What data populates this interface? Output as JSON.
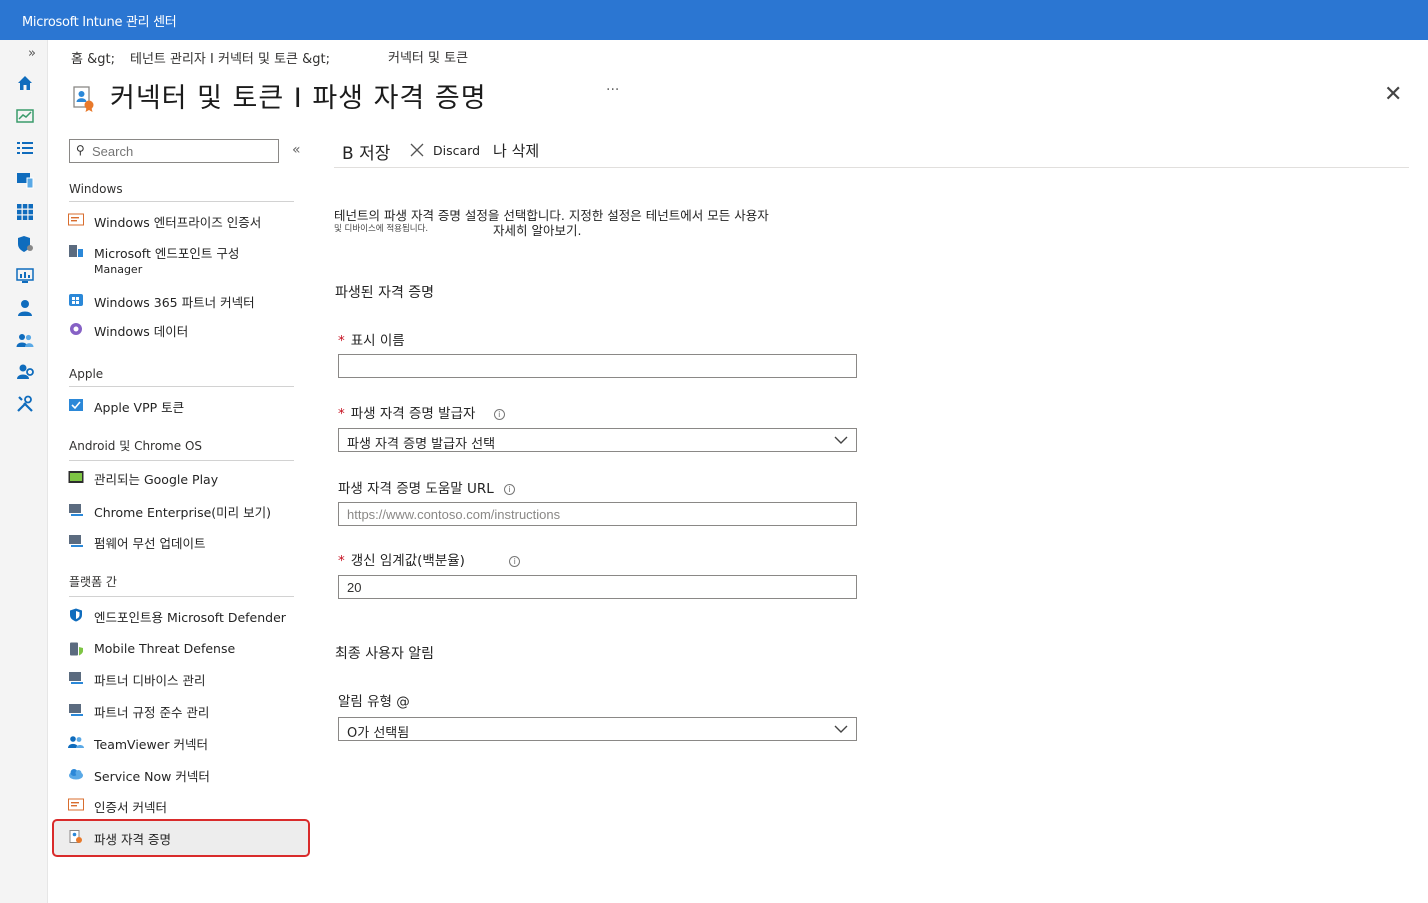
{
  "app": {
    "title": "Microsoft Intune 관리 센터"
  },
  "breadcrumb": {
    "home": "홈 &gt;",
    "tenant": "테넌트 관리자 I 커넥터 및 토큰 &gt;",
    "current": "커넥터 및 토큰"
  },
  "page": {
    "title": "커넥터 및 토큰 I 파생 자격 증명",
    "more": "···",
    "close": "✕"
  },
  "rail": {
    "expand": "»"
  },
  "search": {
    "placeholder": "Search",
    "collapse": "«"
  },
  "nav": {
    "windows_header": "Windows",
    "windows_items": [
      {
        "label": "Windows 엔터프라이즈 인증서"
      },
      {
        "label": "Microsoft 엔드포인트 구성",
        "label2": "Manager"
      },
      {
        "label": "Windows 365 파트너 커넥터"
      },
      {
        "label": "Windows 데이터"
      }
    ],
    "apple_header": "Apple",
    "apple_items": [
      {
        "label": "Apple VPP 토큰"
      }
    ],
    "android_header": "Android 및 Chrome OS",
    "android_items": [
      {
        "label": "관리되는 Google Play"
      },
      {
        "label": "Chrome Enterprise(미리 보기)"
      },
      {
        "label": "펌웨어 무선 업데이트"
      }
    ],
    "cross_header": "플랫폼 간",
    "cross_items": [
      {
        "label": "엔드포인트용 Microsoft Defender"
      },
      {
        "label": "Mobile Threat Defense"
      },
      {
        "label": "파트너 디바이스 관리"
      },
      {
        "label": "파트너 규정 준수 관리"
      },
      {
        "label": "TeamViewer 커넥터"
      },
      {
        "label": "Service Now 커넥터"
      },
      {
        "label": "인증서 커넥터"
      },
      {
        "label": "파생 자격 증명"
      }
    ]
  },
  "toolbar": {
    "save": "B 저장",
    "discard": "Discard",
    "delete": "나 삭제"
  },
  "description": {
    "line1": "테넌트의 파생 자격 증명 설정을 선택합니다. 지정한 설정은 테넌트에서 모든 사용자",
    "line2": "및 디바이스에 적용됩니다.",
    "learn_more": "자세히 알아보기."
  },
  "form": {
    "section1": "파생된 자격 증명",
    "display_name_label": "표시 이름",
    "display_name_value": "",
    "issuer_label": "파생 자격 증명 발급자",
    "issuer_value": "파생 자격 증명 발급자 선택",
    "help_url_label": "파생 자격 증명 도움말 URL",
    "help_url_placeholder": "https://www.contoso.com/instructions",
    "threshold_label": "갱신 임계값(백분율)",
    "threshold_value": "20",
    "section2": "최종 사용자 알림",
    "notification_label": "알림 유형 @",
    "notification_value": "O가 선택됨"
  },
  "colors": {
    "topbar": "#2b76d2",
    "accent": "#0f6cbd",
    "selected_border": "#d92b2b",
    "required": "#c50f1f"
  }
}
